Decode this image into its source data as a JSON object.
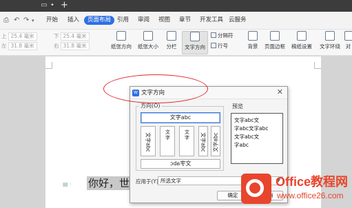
{
  "menu": {
    "items": [
      "开始",
      "插入",
      "页面布局",
      "引用",
      "审阅",
      "视图",
      "章节",
      "开发工具",
      "云服务"
    ],
    "active_index": 2
  },
  "ribbon": {
    "margins": {
      "top_label": "上",
      "top_value": "25.4 毫米",
      "left_label": "左",
      "left_value": "31.8 毫米",
      "bottom_label": "下",
      "bottom_value": "25.4 毫米",
      "right_label": "右",
      "right_value": "31.8 毫米"
    },
    "buttons": {
      "orientation": "纸张方向",
      "size": "纸张大小",
      "columns": "分栏",
      "text_direction": "文字方向",
      "break": "分隔符",
      "line_numbers": "行号",
      "background": "背景",
      "page_border": "页面边框",
      "grid_setup": "稿纸设置",
      "text_wrap": "文字环绕",
      "align": "对"
    }
  },
  "document": {
    "text": "你好，世"
  },
  "dialog": {
    "title": "文字方向",
    "direction_group": "方向(O)",
    "option_horizontal": "文字abc",
    "option_v1": "文字abc",
    "option_v2": "文字",
    "option_v3": "文字",
    "option_v4": "文字abc",
    "option_v5": "文字abc",
    "option_bottom": "文字abc",
    "preview_group": "预览",
    "preview_lines": [
      "文字abc文",
      "字abc文字abc",
      "文字abc文",
      "字abc"
    ],
    "apply_label": "应用于(Y):",
    "apply_value": "所选文字",
    "ok_label": "确定",
    "cancel_label": "取消"
  },
  "watermark": {
    "main": "Office教程网",
    "sub": "www.office26.com"
  },
  "colors": {
    "accent": "#2f6fe4",
    "annotation": "#e0282c",
    "watermark": "#e8452c"
  }
}
